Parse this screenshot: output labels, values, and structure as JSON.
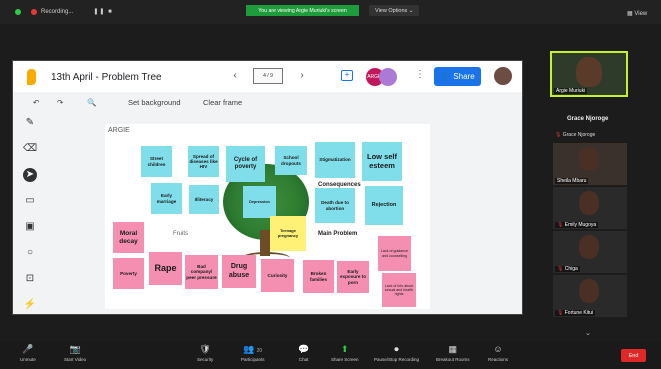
{
  "topbar": {
    "recording_label": "Recording...",
    "pause_label": "❚❚ ■",
    "share_banner": "You are viewing Argie Muriuki's screen",
    "view_options": "View Options ⌄",
    "view_label": "▦ View",
    "colors": {
      "share_banner": "#1e9b3b",
      "rec_dot": "#e53935",
      "status_dot": "#2ecc40"
    }
  },
  "jamboard": {
    "title": "13th April - Problem Tree",
    "page_indicator": "4 / 9",
    "collaborator_initials": "ARGIE",
    "share_label": "Share",
    "toolbar": {
      "undo": "↶",
      "redo": "↷",
      "zoom": "🔍",
      "set_background": "Set background",
      "clear_frame": "Clear frame"
    },
    "tools": [
      "pen-icon",
      "eraser-icon",
      "select-icon",
      "sticky-note-icon",
      "image-icon",
      "circle-icon",
      "text-box-icon",
      "laser-icon"
    ],
    "frame_title": "ARGIE",
    "stickies_cyan": [
      "Street children",
      "Spread of diseases like HIV",
      "Cycle of poverty",
      "School dropouts",
      "Stigmatization",
      "Low self esteem",
      "Early marriage",
      "Illiteracy",
      "Depression",
      "Death due to abortion",
      "Rejection"
    ],
    "stickies_pink": [
      "Moral decay",
      "Poverty",
      "Rape",
      "Bad company/ peer pressure",
      "Drug abuse",
      "Curiosity",
      "Broken families",
      "Early exposure to porn",
      "Lack of guidance and counselling",
      "Lack of info about sexual and health rights"
    ],
    "sticky_yellow": "Teenage pregnancy",
    "labels": {
      "consequences": "Consequences",
      "fruits": "Fruits",
      "main_problem": "Main Problem"
    }
  },
  "participants": {
    "self_name": "Argie Muriuki",
    "header": "Grace Njoroge",
    "list": [
      "Grace Njoroge",
      "Sheila Mbaru",
      "Emily Mugoya",
      "Chiga",
      "Fortune Kitui"
    ]
  },
  "bottombar": {
    "items": [
      {
        "icon": "🎤",
        "label": "Unmute"
      },
      {
        "icon": "📷",
        "label": "Start Video"
      },
      {
        "icon": "🛡",
        "label": "Security"
      },
      {
        "icon": "👥",
        "label": "Participants",
        "count": "20"
      },
      {
        "icon": "💬",
        "label": "Chat"
      },
      {
        "icon": "⬆",
        "label": "Share Screen"
      },
      {
        "icon": "⏺",
        "label": "Pause/Stop Recording"
      },
      {
        "icon": "▦",
        "label": "Breakout Rooms"
      },
      {
        "icon": "☺",
        "label": "Reactions"
      }
    ],
    "end_label": "End"
  }
}
